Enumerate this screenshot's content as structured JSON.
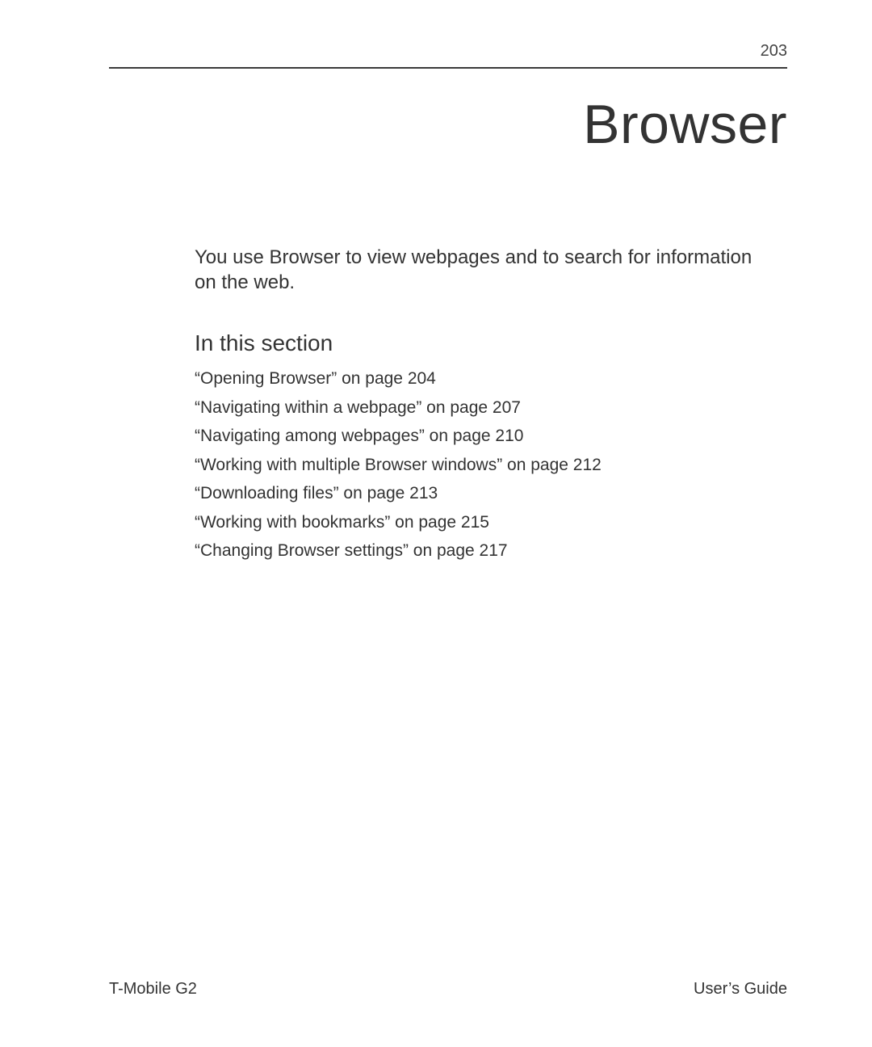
{
  "page_number": "203",
  "chapter_title": "Browser",
  "intro": "You use Browser to view webpages and to search for information on the web.",
  "section_heading": "In this section",
  "toc": [
    "“Opening Browser” on page 204",
    "“Navigating within a webpage” on page 207",
    "“Navigating among webpages” on page 210",
    "“Working with multiple Browser windows” on page 212",
    "“Downloading files” on page 213",
    "“Working with bookmarks” on page 215",
    "“Changing Browser settings” on page 217"
  ],
  "footer_left": "T-Mobile G2",
  "footer_right": "User’s Guide"
}
